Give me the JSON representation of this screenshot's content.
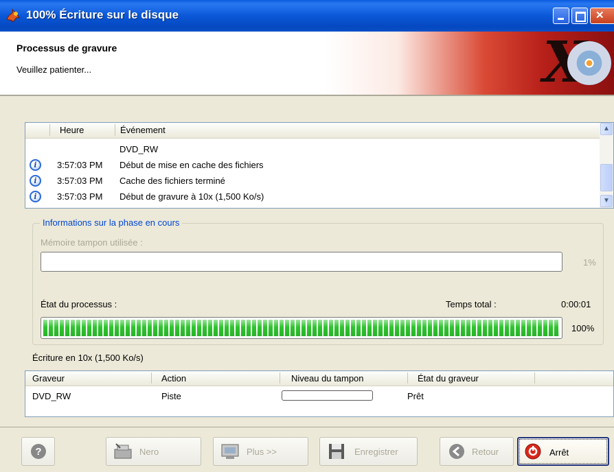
{
  "window": {
    "title": "100% Écriture sur le disque"
  },
  "header": {
    "title": "Processus de gravure",
    "subtitle": "Veuillez patienter..."
  },
  "log": {
    "columns": [
      "Heure",
      "Événement"
    ],
    "rows": [
      {
        "time": "",
        "event": "DVD_RW",
        "icon": ""
      },
      {
        "time": "3:57:03 PM",
        "event": "Début de mise en cache des fichiers",
        "icon": "info-icon"
      },
      {
        "time": "3:57:03 PM",
        "event": "Cache des fichiers terminé",
        "icon": "info-icon"
      },
      {
        "time": "3:57:03 PM",
        "event": "Début de gravure à 10x (1,500 Ko/s)",
        "icon": "info-icon"
      }
    ]
  },
  "phase": {
    "legend": "Informations sur la phase en cours",
    "buffer_label": "Mémoire tampon utilisée :",
    "buffer_percent_text": "1%",
    "buffer_fraction": 0.0,
    "process_label": "État du processus :",
    "total_time_label": "Temps total :",
    "total_time": "0:00:01",
    "process_percent_text": "100%",
    "process_fraction": 1.0
  },
  "status_line": "Écriture en 10x (1,500 Ko/s)",
  "recorders": {
    "columns": [
      "Graveur",
      "Action",
      "Niveau du tampon",
      "État du graveur"
    ],
    "rows": [
      {
        "recorder": "DVD_RW",
        "action": "Piste",
        "buffer_level": 0.0,
        "state": "Prêt"
      }
    ]
  },
  "buttons": {
    "nero": "Nero",
    "more": "Plus >>",
    "save": "Enregistrer",
    "back": "Retour",
    "stop": "Arrêt"
  },
  "colors": {
    "titlebar": "#0a58d8",
    "progress": "#2fc42f",
    "legend": "#0046d5"
  }
}
